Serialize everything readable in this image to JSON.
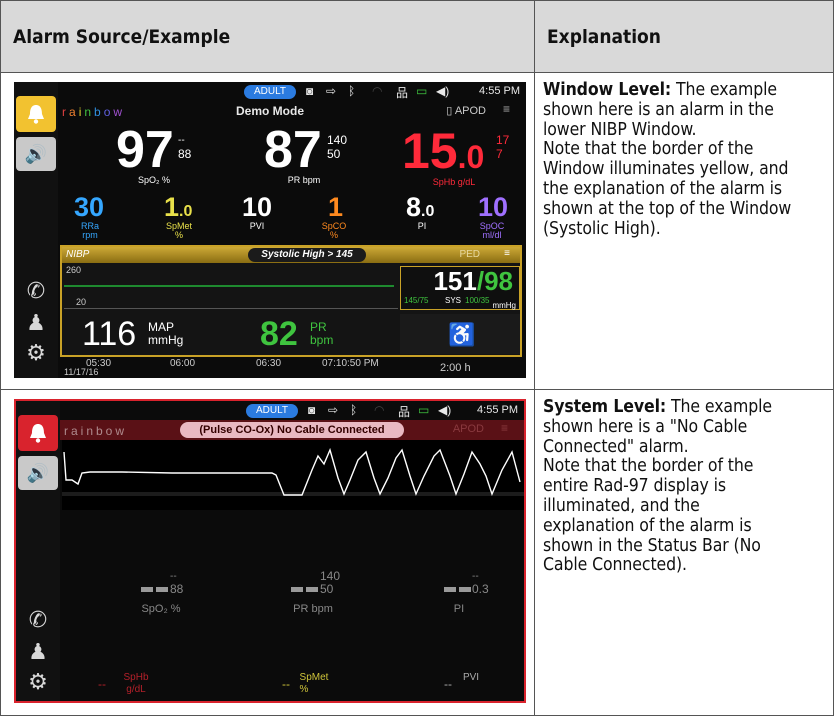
{
  "table": {
    "header_source": "Alarm Source/Example",
    "header_explanation": "Explanation"
  },
  "row1": {
    "title": "Window Level:",
    "lines": [
      "The example",
      "shown here is an alarm in the",
      "lower NIBP Window.",
      "Note that the border of the",
      "Window illuminates yellow, and",
      "the explanation of the alarm is",
      "shown at the top of the Window",
      "(Systolic High)."
    ]
  },
  "row2": {
    "title": "System Level:",
    "lines": [
      "The example",
      "shown here is a \"No Cable",
      "Connected\" alarm.",
      "Note that the border of the",
      "entire Rad-97 display is",
      "illuminated, and the",
      "explanation of the alarm is",
      "shown in the Status Bar (No",
      "Cable Connected)."
    ]
  },
  "screen1": {
    "adult": "ADULT",
    "time": "4:55 PM",
    "brand": "rainbow",
    "mode": "Demo Mode",
    "apod": "APOD",
    "spo2": "97",
    "spo2_hi": "--",
    "spo2_lo": "88",
    "spo2_label": "SpO₂ %",
    "pr": "87",
    "pr_hi": "140",
    "pr_lo": "50",
    "pr_label": "PR bpm",
    "sphb_int": "15",
    "sphb_dec": ".0",
    "sphb_hi": "17",
    "sphb_lo": "7",
    "sphb_label": "SpHb g/dL",
    "rra": "30",
    "rra_label_1": "RRa",
    "rra_label_2": "rpm",
    "spmet": "1",
    "spmet_dec": ".0",
    "spmet_label_1": "SpMet",
    "spmet_label_2": "%",
    "pvi": "10",
    "pvi_label": "PVI",
    "spco": "1",
    "spco_label_1": "SpCO",
    "spco_label_2": "%",
    "pi": "8",
    "pi_dec": ".0",
    "pi_label": "PI",
    "spoc": "10",
    "spoc_label_1": "SpOC",
    "spoc_label_2": "ml/dl",
    "nibp_label": "NIBP",
    "nibp_alarm": "Systolic High > 145",
    "ped": "PED",
    "trend_hi": "260",
    "trend_lo": "20",
    "prev_bp": "145/75",
    "sys_label": "SYS",
    "sys_limits": "100/35",
    "sys": "151",
    "dia": "98",
    "mmhg": "mmHg",
    "map": "116",
    "map_label_1": "MAP",
    "map_label_2": "mmHg",
    "pr2": "82",
    "pr2_label_1": "PR",
    "pr2_label_2": "bpm",
    "t1": "05:30",
    "date": "11/17/16",
    "t2": "06:00",
    "t3": "06:30",
    "t4": "07:10:50 PM",
    "interval": "2:00 h"
  },
  "screen2": {
    "adult": "ADULT",
    "time": "4:55 PM",
    "brand": "rainbow",
    "alarm": "(Pulse CO-Ox) No Cable Connected",
    "apod": "APOD",
    "spo2_hi": "--",
    "spo2_lo": "88",
    "spo2_label": "SpO₂ %",
    "pr_hi": "140",
    "pr_lo": "50",
    "pr_label": "PR bpm",
    "pi_hi": "--",
    "pi_lo": "0.3",
    "pi_label": "PI",
    "sphb_label_1": "SpHb",
    "sphb_label_2": "g/dL",
    "spmet_label_1": "SpMet",
    "spmet_label_2": "%",
    "pvi_label": "PVI"
  },
  "colors": {
    "yellow_alarm": "#f2c230",
    "red_alarm": "#d9232d",
    "spo2": "#ffffff",
    "sphb": "#ff2a3a",
    "rra": "#35a7ff",
    "spmet": "#e8e04a",
    "spco": "#ff8a1f",
    "spoc": "#a070ff",
    "pr_green": "#3fc43f"
  }
}
